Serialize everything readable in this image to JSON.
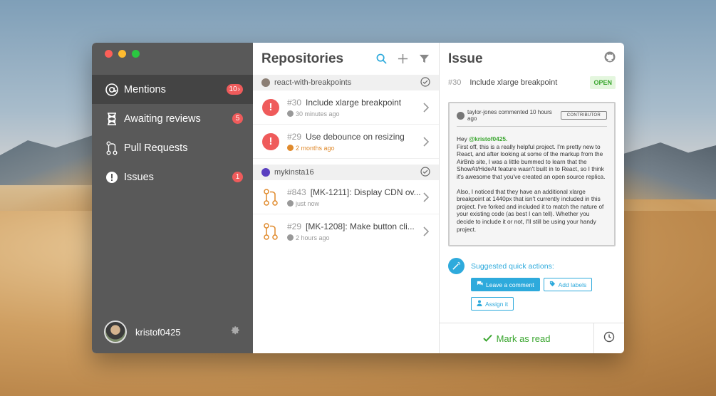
{
  "sidebar": {
    "items": [
      {
        "label": "Mentions",
        "badge": "10"
      },
      {
        "label": "Awaiting reviews",
        "badge": "5"
      },
      {
        "label": "Pull Requests",
        "badge": ""
      },
      {
        "label": "Issues",
        "badge": "1"
      }
    ],
    "username": "kristof0425"
  },
  "repos": {
    "title": "Repositories",
    "groups": [
      {
        "name": "react-with-breakpoints",
        "items": [
          {
            "num": "#30",
            "title": "Include xlarge breakpoint",
            "time": "30 minutes ago"
          },
          {
            "num": "#29",
            "title": "Use debounce on resizing",
            "time": "2 months ago"
          }
        ]
      },
      {
        "name": "mykinsta16",
        "items": [
          {
            "num": "#843",
            "title": "[MK-1211]: Display CDN ov...",
            "time": "just now"
          },
          {
            "num": "#29",
            "title": "[MK-1208]: Make button cli...",
            "time": "2 hours ago"
          }
        ]
      }
    ]
  },
  "issue": {
    "header": "Issue",
    "num": "#30",
    "title": "Include xlarge breakpoint",
    "status": "OPEN",
    "comment": {
      "author_line": "taylor-jones commented 10 hours ago",
      "role": "CONTRIBUTOR",
      "greeting": "Hey",
      "mention": "@kristof0425.",
      "para1": "First off, this is a really helpful project. I'm pretty new to React, and after looking at some of the markup from the AirBnb site, I was a little bummed to learn that the ShowAt/HideAt feature wasn't built in to React, so I think it's awesome that you've created an open source replica.",
      "para2": "Also, I noticed that they have an additional xlarge breakpoint at 1440px that isn't currently included in this project. I've forked and included it to match the nature of your existing code (as best I can tell). Whether you decide to include it or not, I'll still be using your handy project."
    },
    "suggest_label": "Suggested quick actions:",
    "actions": {
      "comment": "Leave a comment",
      "labels": "Add labels",
      "assign": "Assign it"
    },
    "mark_read": "Mark as read"
  },
  "colors": {
    "accent": "#2eaadc",
    "success": "#3aa62f",
    "danger": "#ef5b5b",
    "sidebar": "#595959"
  }
}
